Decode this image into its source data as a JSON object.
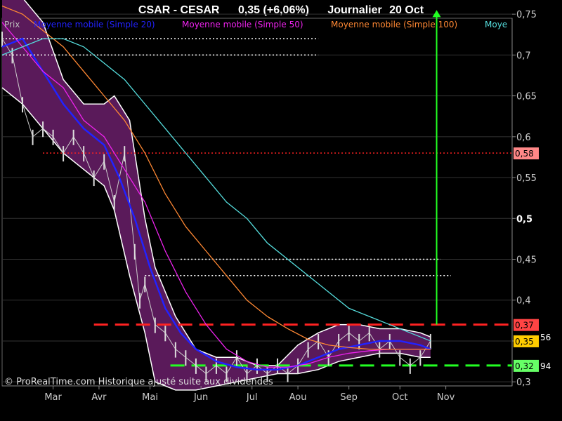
{
  "header": {
    "symbol": "CSAR - CESAR",
    "quote": "0,35 (+6,06%)",
    "period": "Journalier",
    "date": "20 Oct"
  },
  "legend": [
    {
      "label": "Prix",
      "color": "#bbbbbb"
    },
    {
      "label": "Moyenne mobile (Simple 20)",
      "color": "#2222ff"
    },
    {
      "label": "Moyenne mobile (Simple 50)",
      "color": "#ee22ee"
    },
    {
      "label": "Moyenne mobile (Simple 100)",
      "color": "#ff8833"
    },
    {
      "label": "Moye",
      "color": "#55dddd"
    }
  ],
  "footer": "© ProRealTime.com Historique ajusté suite aux dividendes",
  "chart_data": {
    "type": "line",
    "ylim": [
      0.295,
      0.745
    ],
    "y_ticks": [
      {
        "value": 0.3,
        "label": "0,3"
      },
      {
        "value": 0.35,
        "label": "0,35"
      },
      {
        "value": 0.4,
        "label": "0,4"
      },
      {
        "value": 0.45,
        "label": "0,45"
      },
      {
        "value": 0.5,
        "label": "0,5",
        "bold": true
      },
      {
        "value": 0.55,
        "label": "0,55"
      },
      {
        "value": 0.6,
        "label": "0,6"
      },
      {
        "value": 0.65,
        "label": "0,65"
      },
      {
        "value": 0.7,
        "label": "0,7"
      },
      {
        "value": 0.75,
        "label": "0,75"
      }
    ],
    "months": [
      {
        "label": "Mar",
        "x": 0.1
      },
      {
        "label": "Avr",
        "x": 0.19
      },
      {
        "label": "Mai",
        "x": 0.29
      },
      {
        "label": "Jun",
        "x": 0.39
      },
      {
        "label": "Jul",
        "x": 0.49
      },
      {
        "label": "Aou",
        "x": 0.58
      },
      {
        "label": "Sep",
        "x": 0.68
      },
      {
        "label": "Oct",
        "x": 0.78
      },
      {
        "label": "Nov",
        "x": 0.87
      }
    ],
    "series": [
      {
        "key": "price",
        "color": "#cccccc",
        "x": [
          0,
          0.02,
          0.04,
          0.06,
          0.08,
          0.1,
          0.12,
          0.14,
          0.16,
          0.18,
          0.2,
          0.22,
          0.24,
          0.26,
          0.27,
          0.28,
          0.3,
          0.32,
          0.34,
          0.36,
          0.38,
          0.4,
          0.42,
          0.44,
          0.46,
          0.48,
          0.5,
          0.52,
          0.54,
          0.56,
          0.58,
          0.6,
          0.62,
          0.64,
          0.66,
          0.68,
          0.7,
          0.72,
          0.74,
          0.76,
          0.78,
          0.8,
          0.82,
          0.84
        ],
        "values": [
          0.72,
          0.7,
          0.64,
          0.6,
          0.61,
          0.6,
          0.58,
          0.6,
          0.58,
          0.55,
          0.57,
          0.52,
          0.58,
          0.46,
          0.4,
          0.42,
          0.37,
          0.36,
          0.34,
          0.33,
          0.32,
          0.31,
          0.32,
          0.31,
          0.33,
          0.31,
          0.32,
          0.31,
          0.32,
          0.31,
          0.32,
          0.34,
          0.35,
          0.33,
          0.35,
          0.36,
          0.35,
          0.36,
          0.34,
          0.35,
          0.33,
          0.32,
          0.33,
          0.35
        ]
      },
      {
        "key": "sma20",
        "color": "#2222ff",
        "x": [
          0,
          0.04,
          0.08,
          0.12,
          0.16,
          0.2,
          0.23,
          0.26,
          0.29,
          0.32,
          0.35,
          0.38,
          0.42,
          0.46,
          0.5,
          0.54,
          0.58,
          0.62,
          0.66,
          0.7,
          0.74,
          0.78,
          0.82,
          0.84
        ],
        "values": [
          0.71,
          0.72,
          0.68,
          0.64,
          0.61,
          0.59,
          0.55,
          0.5,
          0.44,
          0.39,
          0.36,
          0.34,
          0.325,
          0.318,
          0.315,
          0.315,
          0.32,
          0.33,
          0.34,
          0.345,
          0.35,
          0.35,
          0.345,
          0.34
        ]
      },
      {
        "key": "sma50",
        "color": "#ee22ee",
        "x": [
          0,
          0.04,
          0.08,
          0.12,
          0.16,
          0.2,
          0.24,
          0.28,
          0.32,
          0.36,
          0.4,
          0.44,
          0.48,
          0.52,
          0.56,
          0.6,
          0.64,
          0.68,
          0.72,
          0.76,
          0.8,
          0.84
        ],
        "values": [
          0.74,
          0.71,
          0.68,
          0.66,
          0.62,
          0.6,
          0.56,
          0.52,
          0.46,
          0.41,
          0.37,
          0.34,
          0.325,
          0.318,
          0.318,
          0.322,
          0.33,
          0.335,
          0.338,
          0.34,
          0.34,
          0.34
        ]
      },
      {
        "key": "sma100",
        "color": "#ff8833",
        "x": [
          0,
          0.04,
          0.08,
          0.12,
          0.16,
          0.2,
          0.24,
          0.28,
          0.32,
          0.36,
          0.4,
          0.44,
          0.48,
          0.52,
          0.56,
          0.6,
          0.64,
          0.68,
          0.72,
          0.76,
          0.8,
          0.84
        ],
        "values": [
          0.76,
          0.75,
          0.73,
          0.71,
          0.68,
          0.65,
          0.62,
          0.58,
          0.53,
          0.49,
          0.46,
          0.43,
          0.4,
          0.38,
          0.365,
          0.352,
          0.345,
          0.342,
          0.34,
          0.34,
          0.34,
          0.34
        ]
      },
      {
        "key": "sma150",
        "color": "#55dddd",
        "x": [
          0,
          0.04,
          0.08,
          0.12,
          0.16,
          0.2,
          0.24,
          0.28,
          0.32,
          0.36,
          0.4,
          0.44,
          0.48,
          0.52,
          0.56,
          0.6,
          0.64,
          0.68,
          0.72,
          0.76,
          0.8,
          0.84
        ],
        "values": [
          0.7,
          0.71,
          0.72,
          0.72,
          0.71,
          0.69,
          0.67,
          0.64,
          0.61,
          0.58,
          0.55,
          0.52,
          0.5,
          0.47,
          0.45,
          0.43,
          0.41,
          0.39,
          0.38,
          0.37,
          0.36,
          0.35
        ]
      }
    ],
    "bands": {
      "color": "#5a1a5a",
      "edge": "#ffffff",
      "x": [
        0,
        0.04,
        0.08,
        0.12,
        0.16,
        0.2,
        0.22,
        0.25,
        0.28,
        0.3,
        0.34,
        0.38,
        0.42,
        0.46,
        0.5,
        0.54,
        0.58,
        0.62,
        0.66,
        0.7,
        0.74,
        0.78,
        0.82,
        0.84
      ],
      "upper": [
        0.78,
        0.77,
        0.74,
        0.67,
        0.64,
        0.64,
        0.65,
        0.62,
        0.5,
        0.44,
        0.38,
        0.34,
        0.33,
        0.33,
        0.32,
        0.32,
        0.345,
        0.36,
        0.37,
        0.37,
        0.365,
        0.365,
        0.36,
        0.355
      ],
      "lower": [
        0.66,
        0.64,
        0.61,
        0.58,
        0.56,
        0.54,
        0.51,
        0.43,
        0.36,
        0.3,
        0.29,
        0.29,
        0.295,
        0.3,
        0.305,
        0.31,
        0.31,
        0.315,
        0.325,
        0.33,
        0.335,
        0.335,
        0.33,
        0.33
      ]
    },
    "hlines": [
      {
        "value": 0.72,
        "x0": 0.0,
        "x1": 0.62,
        "color": "#ffffff",
        "style": "dotted"
      },
      {
        "value": 0.7,
        "x0": 0.0,
        "x1": 0.62,
        "color": "#ffffff",
        "style": "dotted"
      },
      {
        "value": 0.58,
        "x0": 0.08,
        "x1": 1.0,
        "color": "#ff2222",
        "style": "dotted"
      },
      {
        "value": 0.45,
        "x0": 0.35,
        "x1": 0.86,
        "color": "#ffffff",
        "style": "dotted"
      },
      {
        "value": 0.43,
        "x0": 0.28,
        "x1": 0.88,
        "color": "#ffffff",
        "style": "dotted"
      },
      {
        "value": 0.37,
        "x0": 0.18,
        "x1": 1.0,
        "color": "#ff2222",
        "style": "dashed"
      },
      {
        "value": 0.32,
        "x0": 0.33,
        "x1": 1.0,
        "color": "#22ff22",
        "style": "dashed"
      }
    ],
    "arrow": {
      "x": 0.852,
      "from": 0.37,
      "to": 0.755,
      "color": "#22ff22"
    },
    "price_tags": [
      {
        "value": 0.58,
        "label": "0,58",
        "bg": "#ff8888",
        "fg": "#000000"
      },
      {
        "value": 0.37,
        "label": "0,37",
        "bg": "#ff4444",
        "fg": "#000000"
      },
      {
        "value": 0.35,
        "label": "0,35",
        "bg": "#ffcc00",
        "fg": "#000000"
      },
      {
        "value": 0.32,
        "label": "0,32",
        "bg": "#66ff66",
        "fg": "#000000"
      }
    ],
    "side_values": [
      {
        "value": 0.355,
        "label": "56"
      },
      {
        "value": 0.32,
        "label": "94"
      }
    ]
  }
}
